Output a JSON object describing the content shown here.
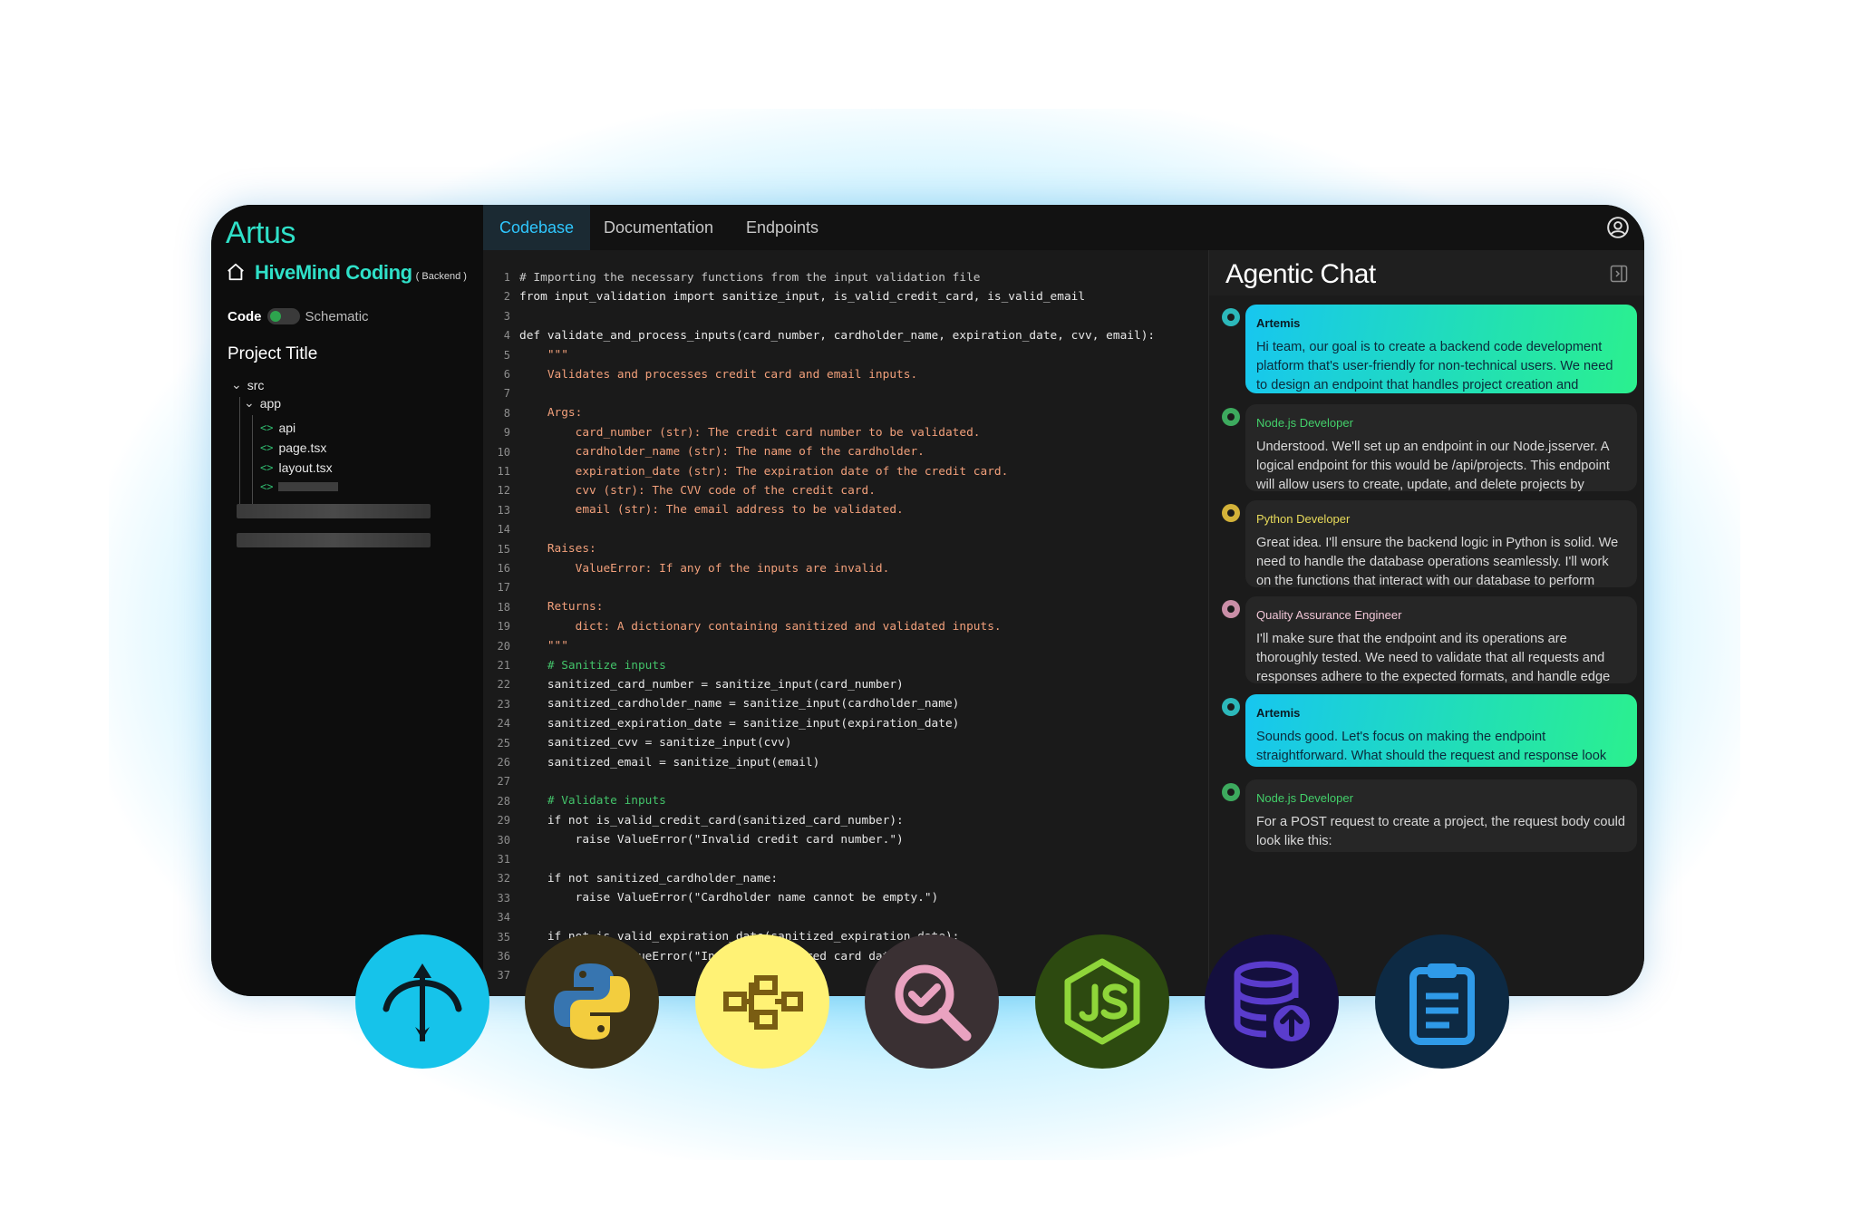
{
  "logo": "Artus",
  "project": {
    "name": "HiveMind Coding",
    "tag": "( Backend )"
  },
  "mode": {
    "code": "Code",
    "schematic": "Schematic"
  },
  "tree": {
    "title": "Project Title",
    "src": "src",
    "app": "app",
    "api": "api",
    "page": "page.tsx",
    "layout": "layout.tsx"
  },
  "tabs": [
    {
      "label": "Codebase",
      "active": true
    },
    {
      "label": "Documentation",
      "active": false
    },
    {
      "label": "Endpoints",
      "active": false
    }
  ],
  "code_lines": [
    [
      "1",
      "# Importing the necessary functions from the input validation file"
    ],
    [
      "2",
      "from input_validation import sanitize_input, is_valid_credit_card, is_valid_email"
    ],
    [
      "3",
      ""
    ],
    [
      "4",
      "def validate_and_process_inputs(card_number, cardholder_name, expiration_date, cvv, email):"
    ],
    [
      "5",
      "    \"\"\""
    ],
    [
      "6",
      "    Validates and processes credit card and email inputs."
    ],
    [
      "7",
      ""
    ],
    [
      "8",
      "    Args:"
    ],
    [
      "9",
      "        card_number (str): The credit card number to be validated."
    ],
    [
      "10",
      "        cardholder_name (str): The name of the cardholder."
    ],
    [
      "11",
      "        expiration_date (str): The expiration date of the credit card."
    ],
    [
      "12",
      "        cvv (str): The CVV code of the credit card."
    ],
    [
      "13",
      "        email (str): The email address to be validated."
    ],
    [
      "14",
      ""
    ],
    [
      "15",
      "    Raises:"
    ],
    [
      "16",
      "        ValueError: If any of the inputs are invalid."
    ],
    [
      "17",
      ""
    ],
    [
      "18",
      "    Returns:"
    ],
    [
      "19",
      "        dict: A dictionary containing sanitized and validated inputs."
    ],
    [
      "20",
      "    \"\"\""
    ],
    [
      "21",
      "    # Sanitize inputs"
    ],
    [
      "22",
      "    sanitized_card_number = sanitize_input(card_number)"
    ],
    [
      "23",
      "    sanitized_cardholder_name = sanitize_input(cardholder_name)"
    ],
    [
      "24",
      "    sanitized_expiration_date = sanitize_input(expiration_date)"
    ],
    [
      "25",
      "    sanitized_cvv = sanitize_input(cvv)"
    ],
    [
      "26",
      "    sanitized_email = sanitize_input(email)"
    ],
    [
      "27",
      ""
    ],
    [
      "28",
      "    # Validate inputs"
    ],
    [
      "29",
      "    if not is_valid_credit_card(sanitized_card_number):"
    ],
    [
      "30",
      "        raise ValueError(\"Invalid credit card number.\")"
    ],
    [
      "31",
      ""
    ],
    [
      "32",
      "    if not sanitized_cardholder_name:"
    ],
    [
      "33",
      "        raise ValueError(\"Cardholder name cannot be empty.\")"
    ],
    [
      "34",
      ""
    ],
    [
      "35",
      "    if not is_valid_expiration_date(sanitized_expiration_date):"
    ],
    [
      "36",
      "        raise ValueError(\"Invalid or expired card date.\")"
    ],
    [
      "37",
      ""
    ]
  ],
  "chat": {
    "title": "Agentic Chat",
    "messages": [
      {
        "sender": "Artemis",
        "style": "grad",
        "text": "Hi team, our goal is to create a backend code development platform that's user-friendly for non-technical users. We need to design an endpoint that handles project creation and management efficiently."
      },
      {
        "sender": "Node.js Developer",
        "style": "dark",
        "text": "Understood. We'll set up an endpoint in our Node.jsserver. A logical endpoint for this would be /api/projects. This endpoint will allow users to create, update, and delete projects by sending requests with project details."
      },
      {
        "sender": "Python Developer",
        "style": "dark",
        "text": "Great idea. I'll ensure the backend logic in Python is solid. We need to handle the database operations seamlessly. I'll work on the functions that interact with our database to perform CRUD operations—create, read, update, delete."
      },
      {
        "sender": "Quality Assurance Engineer",
        "style": "dark",
        "text": "I'll make sure that the endpoint and its operations are thoroughly tested. We need to validate that all requests and responses adhere to the expected formats, and handle edge cases gracefully."
      },
      {
        "sender": "Artemis",
        "style": "grad",
        "text": "Sounds good. Let's focus on making the endpoint straightforward. What should the request and response look like?"
      },
      {
        "sender": "Node.js Developer",
        "style": "dark",
        "text": "For a POST request to create a project, the request body could look like this:"
      }
    ]
  },
  "agents": [
    {
      "name": "artemis-agent-icon",
      "bg": "#16c3ea"
    },
    {
      "name": "python-agent-icon",
      "bg": "#3b3218"
    },
    {
      "name": "schematic-agent-icon",
      "bg": "#fff275"
    },
    {
      "name": "qa-agent-icon",
      "bg": "#3a3033"
    },
    {
      "name": "nodejs-agent-icon",
      "bg": "#2d4a10"
    },
    {
      "name": "database-agent-icon",
      "bg": "#140f3e"
    },
    {
      "name": "docs-agent-icon",
      "bg": "#0d2a44"
    }
  ]
}
